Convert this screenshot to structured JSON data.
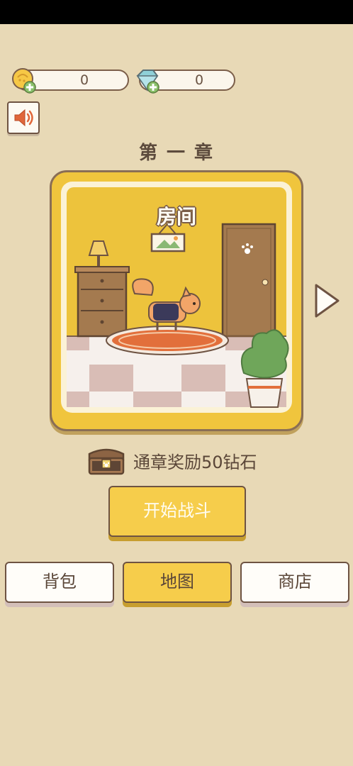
{
  "currency": {
    "coins": "0",
    "gems": "0"
  },
  "chapter": {
    "title": "第 一 章",
    "level_name": "房间"
  },
  "reward": {
    "text": "通章奖励50钻石"
  },
  "buttons": {
    "start": "开始战斗"
  },
  "nav": {
    "bag": "背包",
    "map": "地图",
    "shop": "商店"
  },
  "icons": {
    "coin": "coin-plus-icon",
    "gem": "gem-plus-icon",
    "sound": "speaker-icon",
    "next": "play-triangle-icon",
    "reward": "treasure-chest-icon"
  },
  "colors": {
    "background": "#e8d9b6",
    "accent": "#f6cd4b",
    "outline": "#6e5342"
  }
}
